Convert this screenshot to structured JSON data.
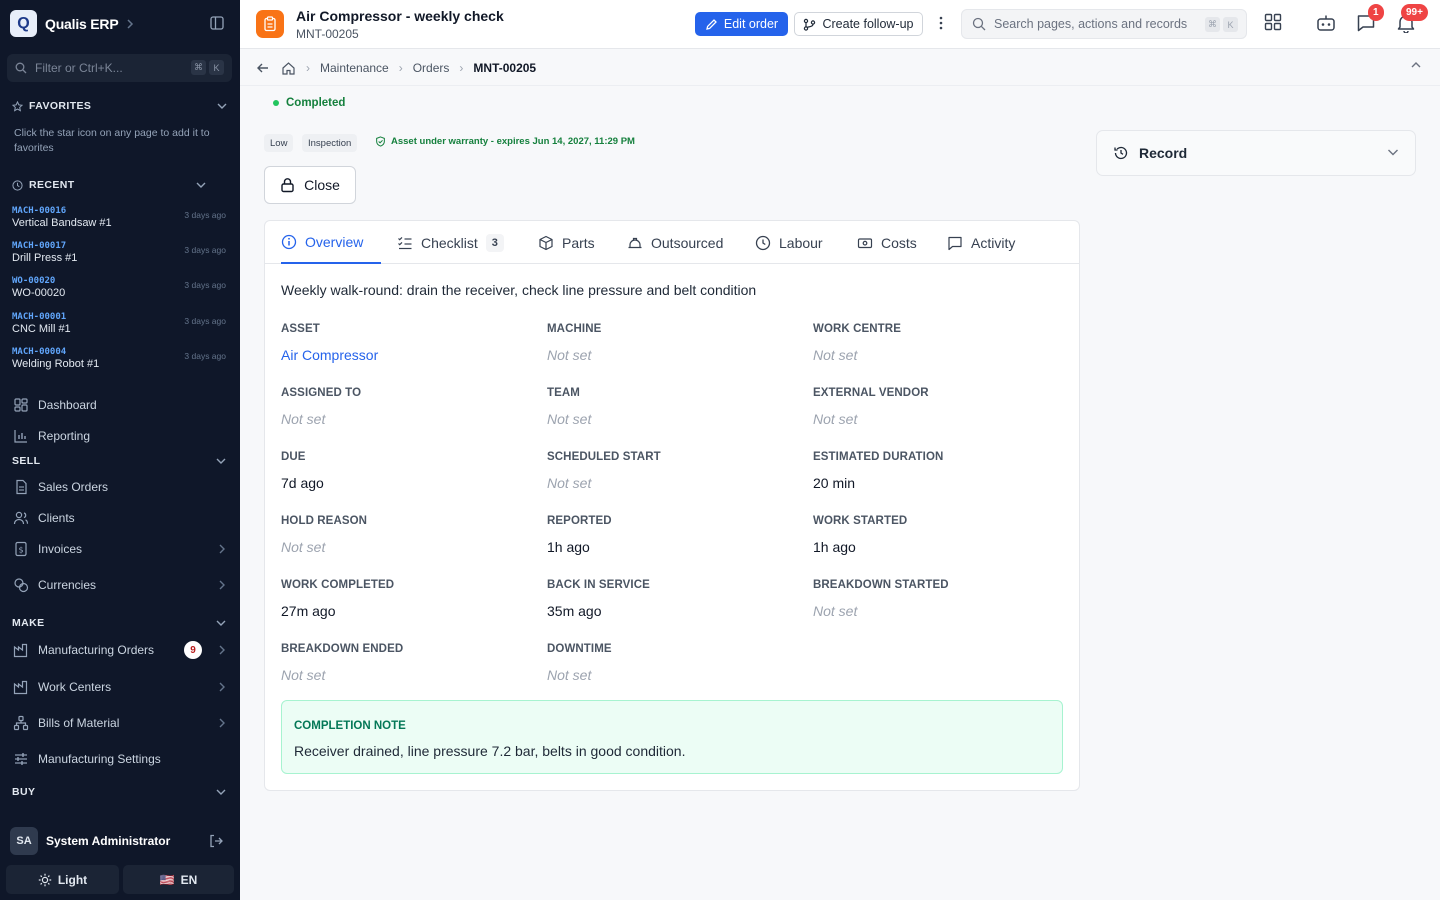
{
  "app": {
    "name": "Qualis ERP",
    "logo_letter": "Q"
  },
  "sidebar": {
    "filter_placeholder": "Filter or Ctrl+K...",
    "filter_keys": [
      "⌘",
      "K"
    ],
    "favorites": {
      "title": "FAVORITES",
      "hint": "Click the star icon on any page to add it to favorites"
    },
    "recent": {
      "title": "RECENT",
      "items": [
        {
          "code": "MACH-00016",
          "name": "Vertical Bandsaw #1",
          "time": "3 days ago"
        },
        {
          "code": "MACH-00017",
          "name": "Drill Press #1",
          "time": "3 days ago"
        },
        {
          "code": "WO-00020",
          "name": "WO-00020",
          "time": "3 days ago"
        },
        {
          "code": "MACH-00001",
          "name": "CNC Mill #1",
          "time": "3 days ago"
        },
        {
          "code": "MACH-00004",
          "name": "Welding Robot #1",
          "time": "3 days ago"
        }
      ]
    },
    "nav": {
      "dashboard": "Dashboard",
      "reporting": "Reporting"
    },
    "sell": {
      "title": "SELL",
      "items": [
        "Sales Orders",
        "Clients",
        "Invoices",
        "Currencies"
      ]
    },
    "make": {
      "title": "MAKE",
      "items": [
        "Manufacturing Orders",
        "Work Centers",
        "Bills of Material",
        "Manufacturing Settings"
      ],
      "mo_badge": "9"
    },
    "buy": {
      "title": "BUY"
    },
    "user": {
      "initials": "SA",
      "name": "System Administrator"
    },
    "theme_label": "Light",
    "lang_label": "EN",
    "lang_flag": "🇺🇸"
  },
  "header": {
    "title": "Air Compressor - weekly check",
    "subtitle": "MNT-00205",
    "edit_label": "Edit order",
    "followup_label": "Create follow-up",
    "search_placeholder": "Search pages, actions and records",
    "search_keys": [
      "⌘",
      "K"
    ],
    "chat_badge": "1",
    "notif_badge": "99+"
  },
  "breadcrumb": {
    "items": [
      "Maintenance",
      "Orders"
    ],
    "current": "MNT-00205"
  },
  "order": {
    "status": "Completed",
    "tags": [
      "Low",
      "Inspection"
    ],
    "warranty": "Asset under warranty - expires Jun 14, 2027, 11:29 PM",
    "close_label": "Close",
    "record_label": "Record"
  },
  "tabs": [
    {
      "label": "Overview"
    },
    {
      "label": "Checklist",
      "count": "3"
    },
    {
      "label": "Parts"
    },
    {
      "label": "Outsourced"
    },
    {
      "label": "Labour"
    },
    {
      "label": "Costs"
    },
    {
      "label": "Activity"
    }
  ],
  "overview": {
    "description": "Weekly walk-round: drain the receiver, check line pressure and belt condition",
    "fields": [
      {
        "label": "ASSET",
        "value": "Air Compressor"
      },
      {
        "label": "MACHINE",
        "value": "Not set"
      },
      {
        "label": "WORK CENTRE",
        "value": "Not set"
      },
      {
        "label": "ASSIGNED TO",
        "value": "Not set"
      },
      {
        "label": "TEAM",
        "value": "Not set"
      },
      {
        "label": "EXTERNAL VENDOR",
        "value": "Not set"
      },
      {
        "label": "DUE",
        "value": "7d ago"
      },
      {
        "label": "SCHEDULED START",
        "value": "Not set"
      },
      {
        "label": "ESTIMATED DURATION",
        "value": "20 min"
      },
      {
        "label": "HOLD REASON",
        "value": "Not set"
      },
      {
        "label": "REPORTED",
        "value": "1h ago"
      },
      {
        "label": "WORK STARTED",
        "value": "1h ago"
      },
      {
        "label": "WORK COMPLETED",
        "value": "27m ago"
      },
      {
        "label": "BACK IN SERVICE",
        "value": "35m ago"
      },
      {
        "label": "BREAKDOWN STARTED",
        "value": "Not set"
      },
      {
        "label": "BREAKDOWN ENDED",
        "value": "Not set"
      },
      {
        "label": "DOWNTIME",
        "value": "Not set"
      }
    ],
    "completion_note": {
      "label": "COMPLETION NOTE",
      "text": "Receiver drained, line pressure 7.2 bar, belts in good condition."
    }
  },
  "colors": {
    "sidebar_bg": "#0f1729",
    "primary": "#2563eb",
    "accent": "#f97316",
    "success": "#15803d",
    "badge": "#ef4444"
  }
}
